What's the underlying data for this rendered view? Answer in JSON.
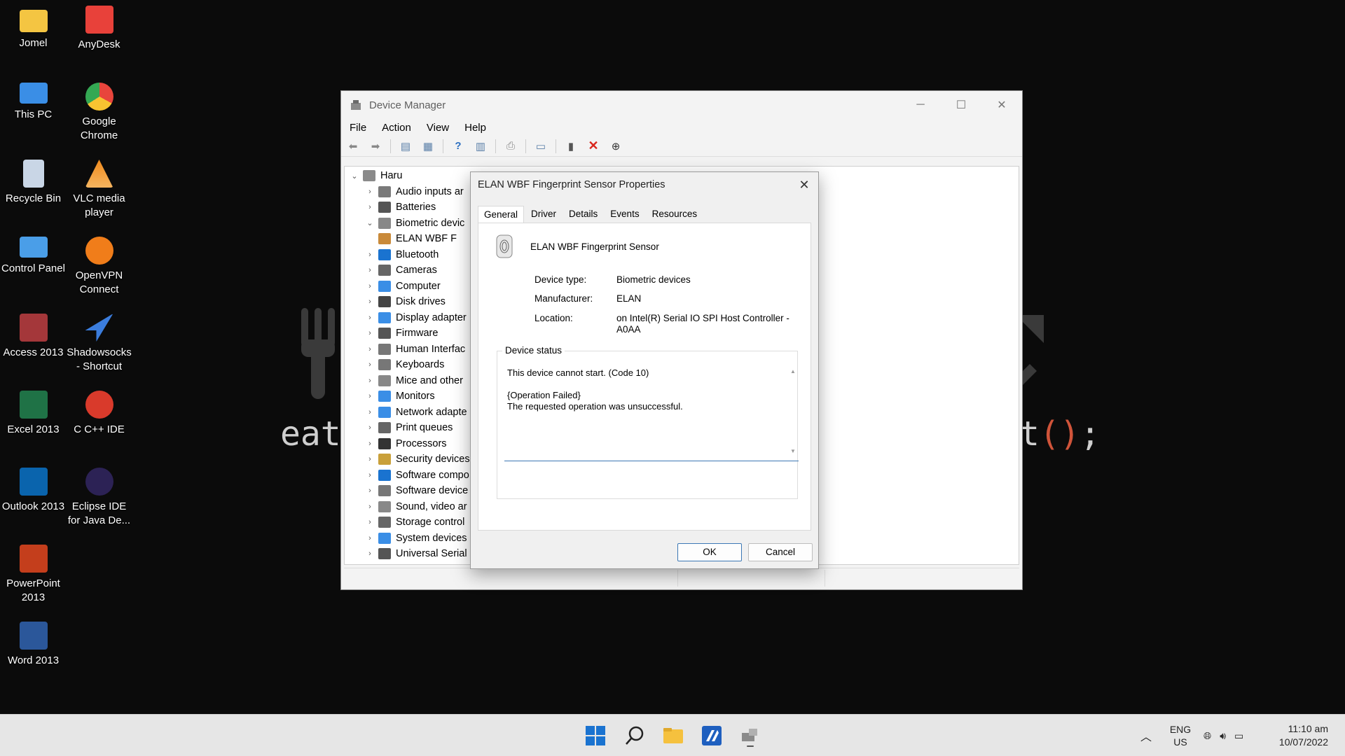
{
  "desktop": {
    "wallpaper_left": "eat",
    "wallpaper_right_prefix": "t",
    "wallpaper_right_parens": "()",
    "wallpaper_right_suffix": ";",
    "icons": [
      {
        "label": "Jomel",
        "icon": "folder-icon",
        "color": "#f4c542"
      },
      {
        "label": "AnyDesk",
        "icon": "anydesk-icon",
        "color": "#e8413a"
      },
      {
        "label": "This PC",
        "icon": "monitor-icon",
        "color": "#3a8ee6"
      },
      {
        "label": "Google Chrome",
        "icon": "chrome-icon",
        "color": "#e8453c"
      },
      {
        "label": "Recycle Bin",
        "icon": "recycle-bin-icon",
        "color": "#c9d6e6"
      },
      {
        "label": "VLC media player",
        "icon": "vlc-icon",
        "color": "#f08a1c"
      },
      {
        "label": "Control Panel",
        "icon": "control-panel-icon",
        "color": "#4a9ee8"
      },
      {
        "label": "OpenVPN Connect",
        "icon": "openvpn-icon",
        "color": "#f07d1a"
      },
      {
        "label": "Access 2013",
        "icon": "access-icon",
        "color": "#a4373a"
      },
      {
        "label": "Shadowsocks - Shortcut",
        "icon": "shadowsocks-icon",
        "color": "#3b7ddd"
      },
      {
        "label": "Excel 2013",
        "icon": "excel-icon",
        "color": "#1f7246"
      },
      {
        "label": "C C++ IDE",
        "icon": "dev-cpp-icon",
        "color": "#d93a2b"
      },
      {
        "label": "Outlook 2013",
        "icon": "outlook-icon",
        "color": "#0a64ad"
      },
      {
        "label": "Eclipse IDE for Java De...",
        "icon": "eclipse-icon",
        "color": "#2c2255"
      },
      {
        "label": "PowerPoint 2013",
        "icon": "powerpoint-icon",
        "color": "#c43e1c"
      },
      {
        "label": "Word 2013",
        "icon": "word-icon",
        "color": "#2b579a"
      }
    ]
  },
  "device_manager": {
    "title": "Device Manager",
    "menu": [
      "File",
      "Action",
      "View",
      "Help"
    ],
    "tree": {
      "root": "Haru",
      "items": [
        {
          "label": "Audio inputs ar",
          "expanded": false
        },
        {
          "label": "Batteries",
          "expanded": false
        },
        {
          "label": "Biometric devic",
          "expanded": true
        },
        {
          "label": "ELAN WBF F",
          "child": true
        },
        {
          "label": "Bluetooth",
          "expanded": false
        },
        {
          "label": "Cameras",
          "expanded": false
        },
        {
          "label": "Computer",
          "expanded": false
        },
        {
          "label": "Disk drives",
          "expanded": false
        },
        {
          "label": "Display adapter",
          "expanded": false
        },
        {
          "label": "Firmware",
          "expanded": false
        },
        {
          "label": "Human Interfac",
          "expanded": false
        },
        {
          "label": "Keyboards",
          "expanded": false
        },
        {
          "label": "Mice and other",
          "expanded": false
        },
        {
          "label": "Monitors",
          "expanded": false
        },
        {
          "label": "Network adapte",
          "expanded": false
        },
        {
          "label": "Print queues",
          "expanded": false
        },
        {
          "label": "Processors",
          "expanded": false
        },
        {
          "label": "Security devices",
          "expanded": false
        },
        {
          "label": "Software compo",
          "expanded": false
        },
        {
          "label": "Software device",
          "expanded": false
        },
        {
          "label": "Sound, video ar",
          "expanded": false
        },
        {
          "label": "Storage control",
          "expanded": false
        },
        {
          "label": "System devices",
          "expanded": false
        },
        {
          "label": "Universal Serial",
          "expanded": false
        }
      ]
    }
  },
  "properties_dialog": {
    "title": "ELAN WBF Fingerprint Sensor Properties",
    "tabs": [
      "General",
      "Driver",
      "Details",
      "Events",
      "Resources"
    ],
    "active_tab": "General",
    "device_name": "ELAN WBF Fingerprint Sensor",
    "device_type_label": "Device type:",
    "device_type_value": "Biometric devices",
    "manufacturer_label": "Manufacturer:",
    "manufacturer_value": "ELAN",
    "location_label": "Location:",
    "location_value": "on Intel(R) Serial IO SPI Host Controller - A0AA",
    "device_status_label": "Device status",
    "status_line1": "This device cannot start. (Code 10)",
    "status_line2": "{Operation Failed}",
    "status_line3": "The requested operation was unsuccessful.",
    "ok_label": "OK",
    "cancel_label": "Cancel"
  },
  "taskbar": {
    "lang_top": "ENG",
    "lang_bottom": "US",
    "time": "11:10 am",
    "date": "10/07/2022"
  }
}
